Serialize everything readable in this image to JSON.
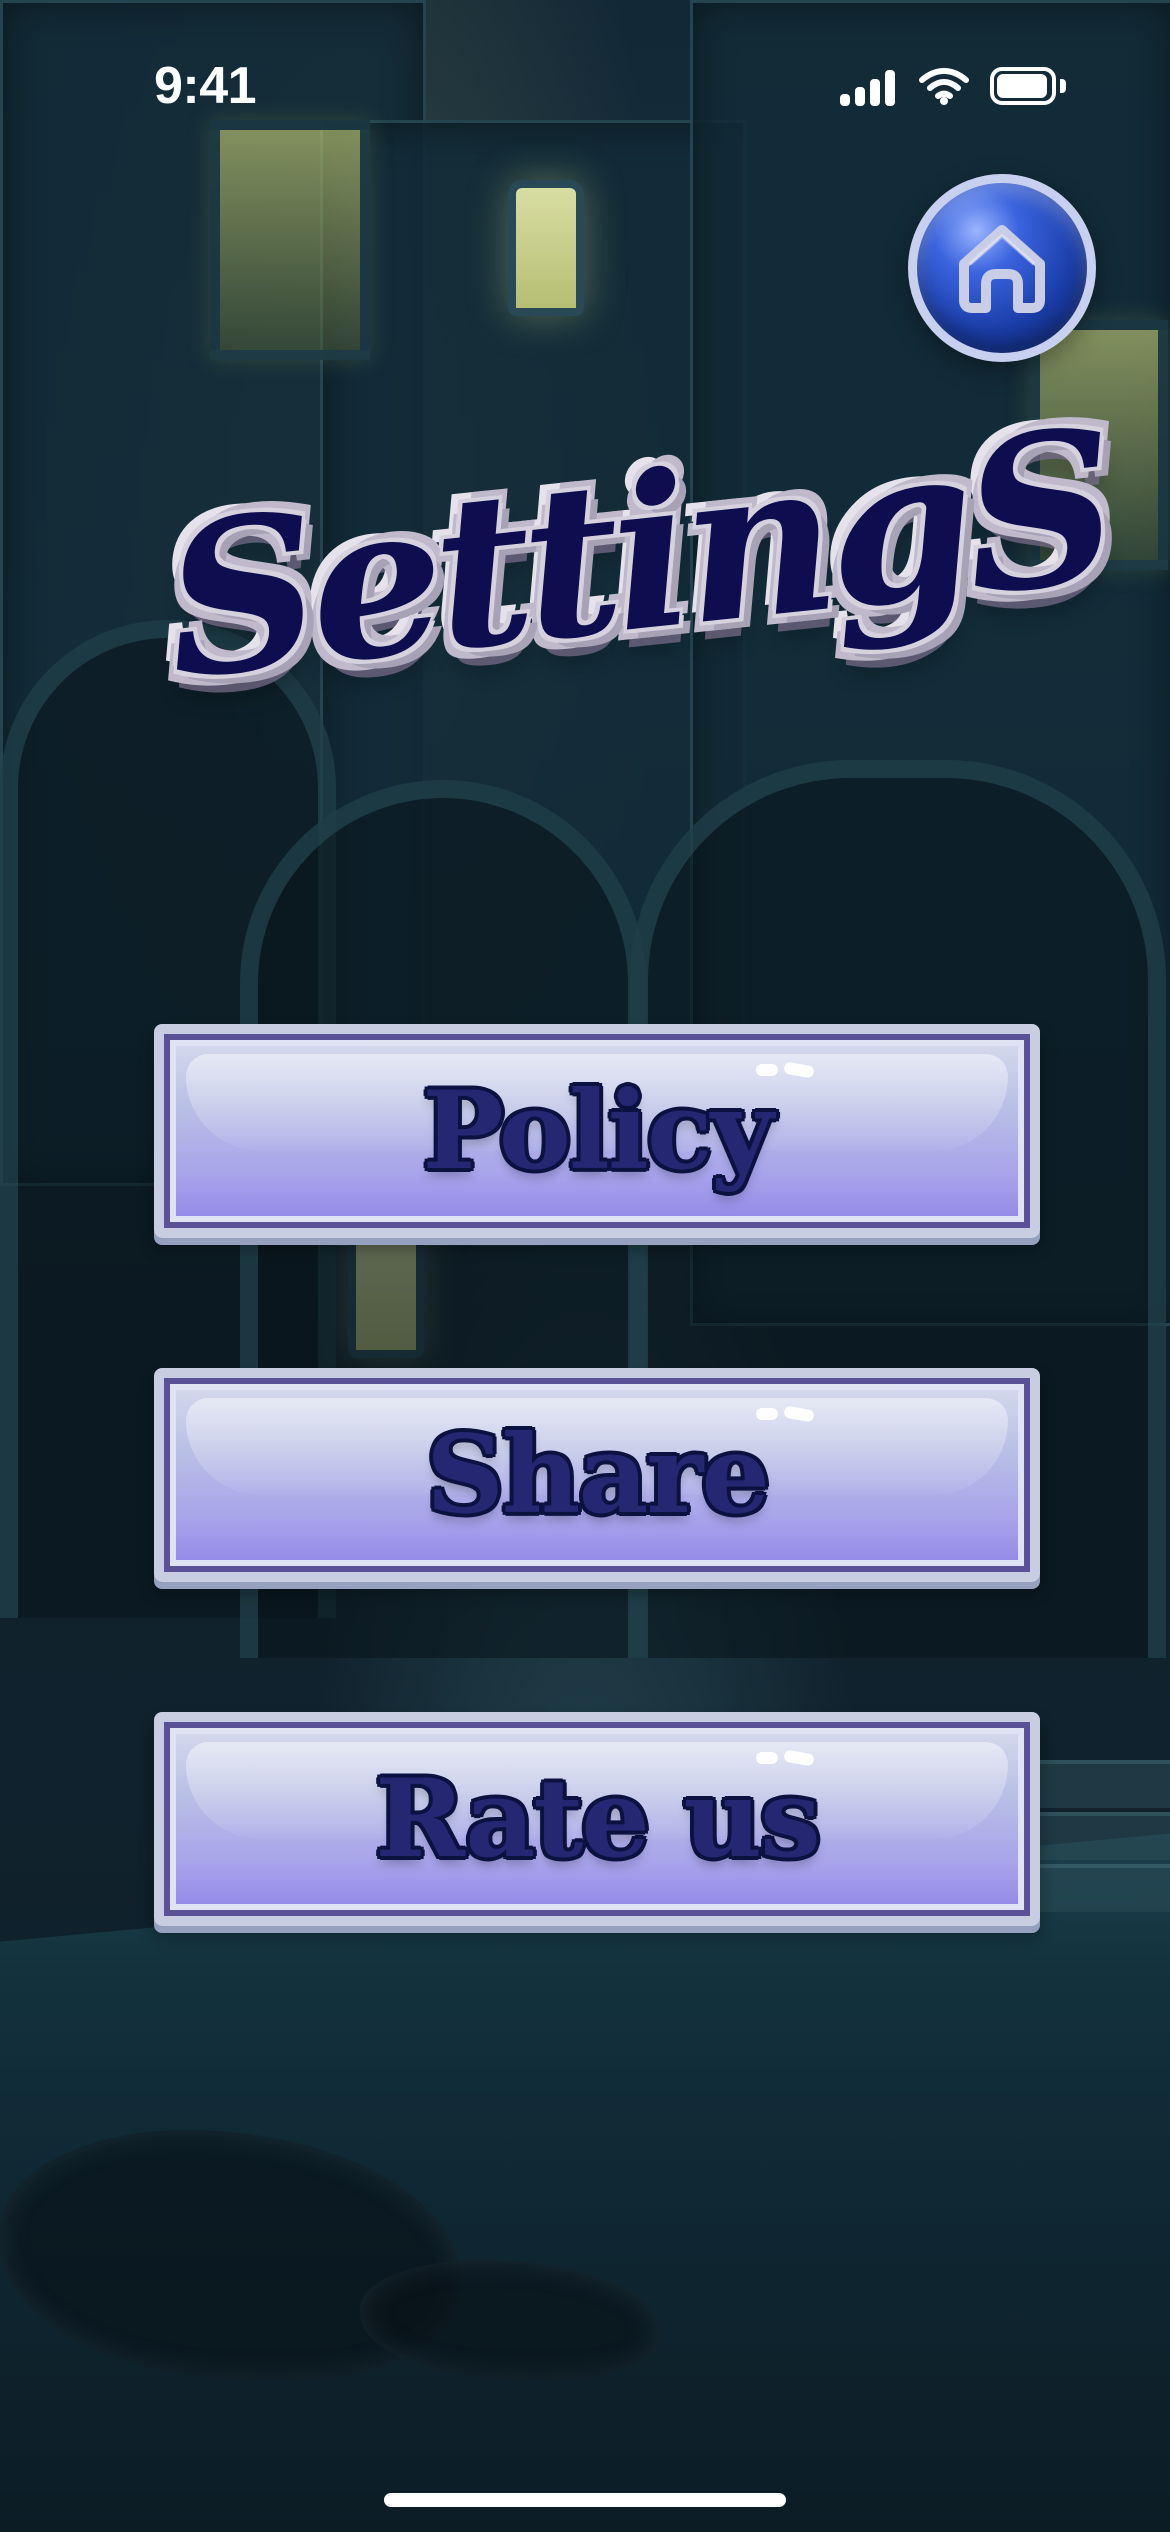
{
  "status_bar": {
    "time": "9:41"
  },
  "header": {
    "title": "SettingS"
  },
  "menu": {
    "items": [
      {
        "label": "Policy"
      },
      {
        "label": "Share"
      },
      {
        "label": "Rate us"
      }
    ]
  },
  "icons": {
    "home": "home-icon",
    "signal": "signal-icon",
    "wifi": "wifi-icon",
    "battery": "battery-icon"
  },
  "colors": {
    "background_dark": "#0f2230",
    "title_navy": "#0d0d4f",
    "button_light": "#d8dced",
    "button_purple": "#8f85e7",
    "home_blue": "#1a3da8"
  }
}
